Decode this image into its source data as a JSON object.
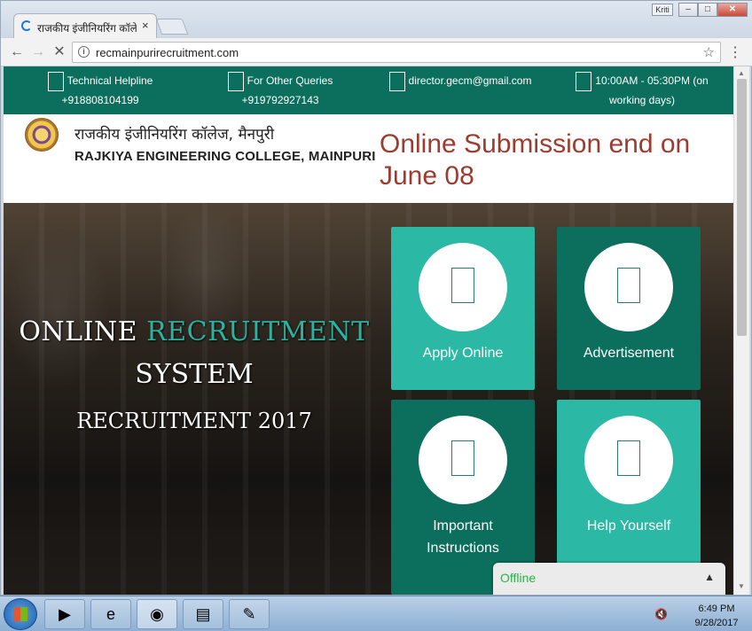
{
  "browser": {
    "tab_title": "राजकीय इंजीनियरिंग कॉलेज",
    "tab_close": "×",
    "user_chip": "Kriti",
    "url": "recmainpurirecruitment.com",
    "window_controls": {
      "minimize": "–",
      "maximize": "□",
      "close": "✕"
    },
    "nav": {
      "back": "←",
      "forward": "→",
      "stop": "✕",
      "info": "i",
      "star": "☆",
      "menu": "⋮"
    }
  },
  "topbar": {
    "contacts": [
      {
        "label": "Technical Helpline",
        "value": "+918808104199"
      },
      {
        "label": "For Other Queries",
        "value": "+919792927143"
      },
      {
        "label": "director.gecm@gmail.com",
        "value": ""
      },
      {
        "label": "10:00AM - 05:30PM (on",
        "value": "working days)"
      }
    ]
  },
  "header": {
    "college_hindi": "राजकीय इंजीनियरिंग कॉलेज, मैनपुरी",
    "college_english": "RAJKIYA ENGINEERING COLLEGE, MAINPURI",
    "notice": "Online Submission end on June 08"
  },
  "hero": {
    "line1_a": "ONLINE ",
    "line1_b": "RECRUITMENT",
    "line2": "SYSTEM",
    "line3": "RECRUITMENT 2017"
  },
  "tiles": [
    {
      "label": "Apply Online"
    },
    {
      "label": "Advertisement"
    },
    {
      "label_line1": "Important",
      "label_line2": "Instructions"
    },
    {
      "label": "Help Yourself"
    }
  ],
  "chat": {
    "status": "Offline",
    "toggle": "▲"
  },
  "taskbar": {
    "clock_time": "6:49 PM",
    "clock_date": "9/28/2017"
  },
  "colors": {
    "brand_dark": "#0c6e5c",
    "brand_light": "#2bb8a4",
    "notice": "#9e3b2f",
    "chat_status": "#2bb04a"
  }
}
